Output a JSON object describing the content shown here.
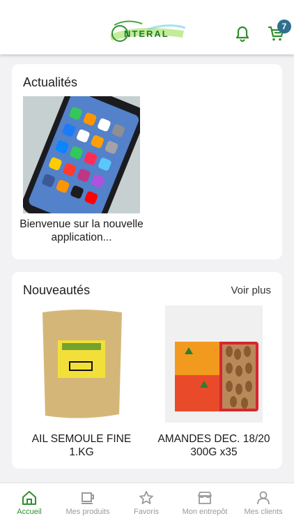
{
  "header": {
    "logo_text": "NTERAL",
    "notifications_icon": "bell-icon",
    "cart_icon": "cart-icon",
    "cart_count": "7",
    "accent_color": "#2f8f2f",
    "badge_color": "#2f6f8f"
  },
  "news": {
    "title": "Actualités",
    "items": [
      {
        "caption": "Bienvenue sur la nouvelle application..."
      }
    ]
  },
  "new_products": {
    "title": "Nouveautés",
    "see_more": "Voir plus",
    "items": [
      {
        "name": "AIL SEMOULE FINE 1.KG"
      },
      {
        "name": "AMANDES DEC. 18/20 300G  x35"
      }
    ]
  },
  "tabbar": {
    "items": [
      {
        "label": "Accueil",
        "icon": "home-icon",
        "active": true
      },
      {
        "label": "Mes produits",
        "icon": "mug-icon",
        "active": false
      },
      {
        "label": "Favoris",
        "icon": "star-icon",
        "active": false
      },
      {
        "label": "Mon entrepôt",
        "icon": "store-icon",
        "active": false
      },
      {
        "label": "Mes clients",
        "icon": "user-icon",
        "active": false
      }
    ]
  }
}
